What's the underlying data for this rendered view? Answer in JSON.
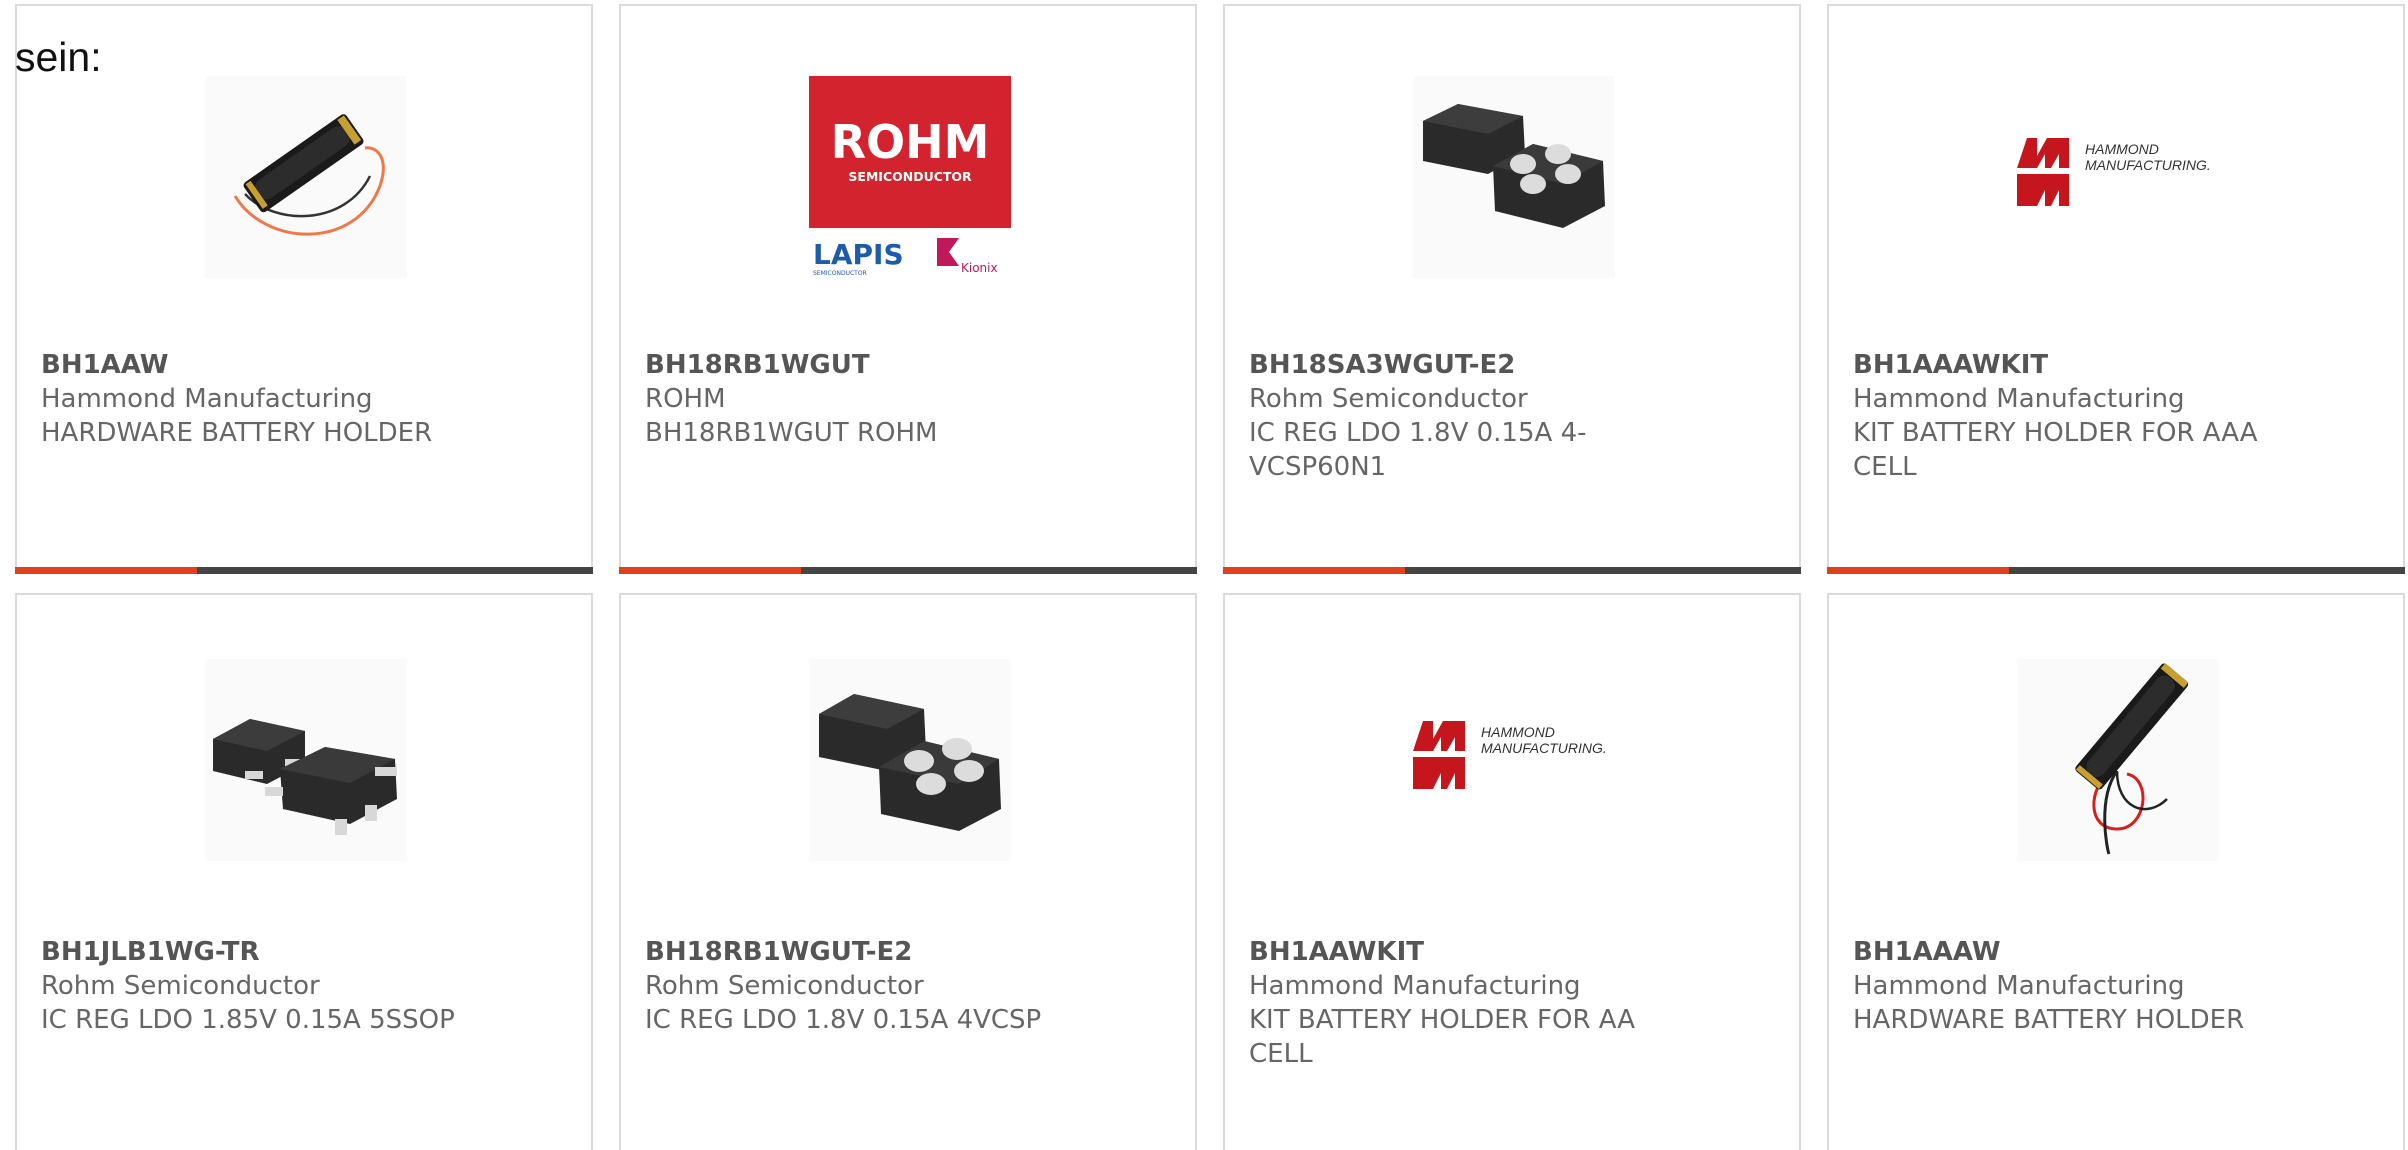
{
  "intro_text": "sein:",
  "colors": {
    "accent": "#e0401c",
    "bar": "#444444",
    "border": "#dadada"
  },
  "products": [
    {
      "part_number": "BH1AAW",
      "manufacturer": "Hammond Manufacturing",
      "description": "HARDWARE BATTERY HOLDER",
      "image": "battery-holder-aa-wired"
    },
    {
      "part_number": "BH18RB1WGUT",
      "manufacturer": "ROHM",
      "description": "BH18RB1WGUT ROHM",
      "image": "rohm-lapis-kionix-logo",
      "logo": {
        "brand": "ROHM",
        "sub": "SEMICONDUCTOR",
        "lapis": "LAPIS",
        "lapis_sub": "SEMICONDUCTOR",
        "kionix": "Kionix"
      }
    },
    {
      "part_number": "BH18SA3WGUT-E2",
      "manufacturer": "Rohm Semiconductor",
      "description_lines": [
        "IC REG LDO 1.8V 0.15A 4-",
        "VCSP60N1"
      ],
      "image": "vcsp-chip"
    },
    {
      "part_number": "BH1AAAWKIT",
      "manufacturer": "Hammond Manufacturing",
      "description_lines": [
        "KIT BATTERY HOLDER FOR AAA",
        "CELL"
      ],
      "image": "hammond-logo",
      "logo": {
        "line1": "HAMMOND",
        "line2": "MANUFACTURING."
      }
    },
    {
      "part_number": "BH1JLB1WG-TR",
      "manufacturer": "Rohm Semiconductor",
      "description": "IC REG LDO 1.85V 0.15A 5SSOP",
      "image": "ssop-chip"
    },
    {
      "part_number": "BH18RB1WGUT-E2",
      "manufacturer": "Rohm Semiconductor",
      "description": "IC REG LDO 1.8V 0.15A 4VCSP",
      "image": "vcsp-chip"
    },
    {
      "part_number": "BH1AAWKIT",
      "manufacturer": "Hammond Manufacturing",
      "description_lines": [
        "KIT BATTERY HOLDER FOR AA",
        "CELL"
      ],
      "image": "hammond-logo",
      "logo": {
        "line1": "HAMMOND",
        "line2": "MANUFACTURING."
      }
    },
    {
      "part_number": "BH1AAAW",
      "manufacturer": "Hammond Manufacturing",
      "description": "HARDWARE BATTERY HOLDER",
      "image": "battery-holder-aaa-wired"
    }
  ]
}
